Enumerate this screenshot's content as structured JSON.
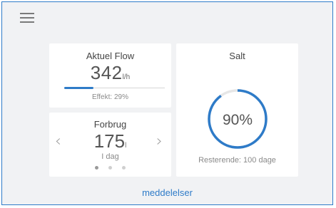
{
  "flow": {
    "title": "Aktuel Flow",
    "value": "342",
    "unit": "l/h",
    "effect": "Effekt: 29%",
    "effect_fraction": 0.29
  },
  "usage": {
    "title": "Forbrug",
    "value": "175",
    "unit": "l",
    "period": "I dag",
    "page_count": 3,
    "active_page": 1
  },
  "salt": {
    "title": "Salt",
    "percent_label": "90%",
    "percent": 90,
    "remaining": "Resterende: 100 dage"
  },
  "footer": {
    "messages_label": "meddelelser"
  },
  "colors": {
    "accent": "#2e7bc8",
    "frame_border": "#2e7bc8",
    "background": "#f1f2f4",
    "card": "#ffffff",
    "inactive_dot": "#cfcfcf"
  },
  "icons": {
    "menu": "hamburger-menu-icon",
    "previous": "chevron-left-icon",
    "next": "chevron-right-icon"
  }
}
